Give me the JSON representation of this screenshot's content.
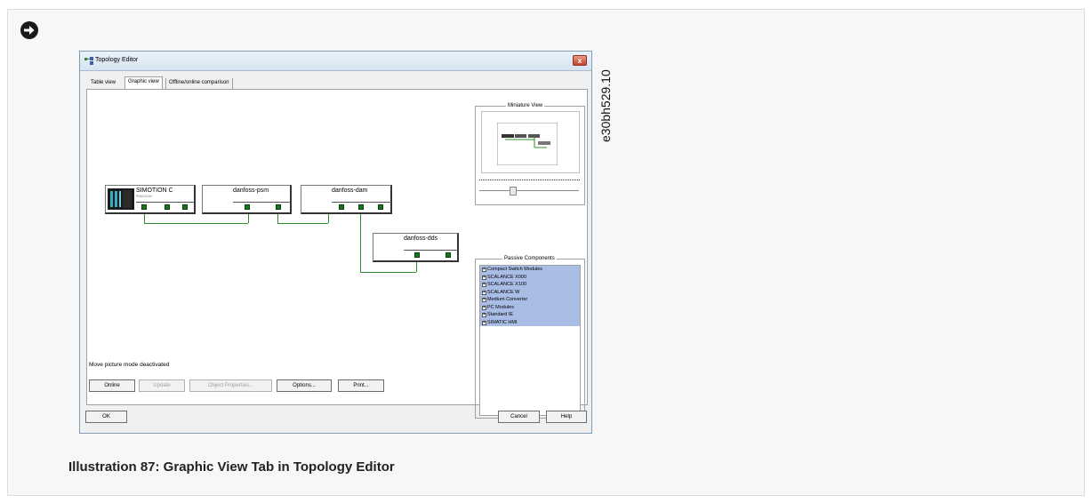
{
  "caption": "Illustration 87: Graphic View Tab in Topology Editor",
  "image_id_label": "e30bh529.10",
  "window": {
    "title": "Topology Editor",
    "close_label": "x"
  },
  "tabs": [
    "Table view",
    "Graphic view",
    "Offline/online comparison"
  ],
  "devices": {
    "simotion": {
      "name": "SIMOTION C",
      "sub": "PN&DCOM"
    },
    "psm": {
      "name": "danfoss-psm"
    },
    "dam": {
      "name": "danfoss-dam"
    },
    "dds": {
      "name": "danfoss-dds"
    }
  },
  "status_text": "Move picture mode deactivated",
  "miniature_view": {
    "title": "Miniature View"
  },
  "passive_components": {
    "title": "Passive Components",
    "items": [
      "Compact Switch Modules",
      "SCALANCE X000",
      "SCALANCE X100",
      "SCALANCE W",
      "Medium Converter",
      "PC Modules",
      "Standard IE",
      "SIMATIC HMI"
    ]
  },
  "buttons": {
    "online": "Online",
    "update": "Update",
    "object_properties": "Object Properties...",
    "options": "Options...",
    "print": "Print...",
    "ok": "OK",
    "cancel": "Cancel",
    "help": "Help"
  },
  "colors": {
    "link_green": "#2e8b2e",
    "port_green": "#18761e",
    "list_highlight": "#aabde6"
  }
}
